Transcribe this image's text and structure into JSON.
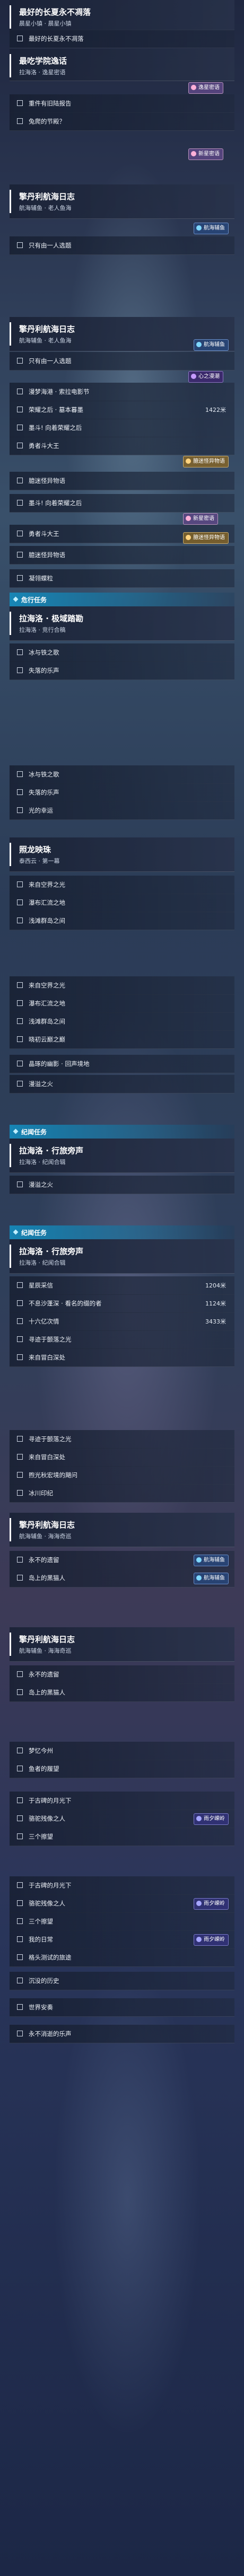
{
  "cards": [
    {
      "title": "最好的长夏永不凋落",
      "sub": "晨星小镇 · 晨星小镇"
    },
    {
      "title": "最吃学院逸话",
      "sub": "拉海洛 · 逸星密语"
    },
    {
      "title": "擎丹利航海日志",
      "sub": "航海辅鱼 · 老人鱼海"
    },
    {
      "title": "擎丹利航海日志",
      "sub": "航海辅鱼 · 老人鱼海"
    },
    {
      "title": "拉海洛 · 极域踏勘",
      "sub": "拉海洛 · 竞行合稿"
    },
    {
      "title": "照龙映珠",
      "sub": "泰西云 · 第一幕"
    },
    {
      "title": "拉海洛 · 行旅旁声",
      "sub": "拉海洛 · 纪闻合辑"
    },
    {
      "title": "拉海洛 · 行旅旁声",
      "sub": "拉海洛 · 纪闻合辑"
    },
    {
      "title": "擎丹利航海日志",
      "sub": "航海辅鱼 · 海海奇巡"
    },
    {
      "title": "擎丹利航海日志",
      "sub": "航海辅鱼 · 海海奇巡"
    }
  ],
  "sections": [
    "危行任务",
    "纪闻任务",
    "纪闻任务"
  ],
  "rows": [
    {
      "label": "最好的长夏永不凋落"
    },
    {
      "label": "重件有旧陆报告"
    },
    {
      "label": "兔爬的节殿？"
    },
    {
      "label": "只有由一人选题"
    },
    {
      "label": "只有由一人选题"
    },
    {
      "label": "漫梦海港 · 索拉电影节"
    },
    {
      "label": "荣耀之后 · 墓本暮墨",
      "value": "1422米"
    },
    {
      "label": "墨斗! 向着荣耀之后"
    },
    {
      "label": "勇者斗大王"
    },
    {
      "label": "臆迷怪异物语"
    },
    {
      "label": "墨斗! 向着荣耀之后"
    },
    {
      "label": "勇者斗大王"
    },
    {
      "label": "臆迷怪异物语"
    },
    {
      "label": "凝翎蝶粒"
    },
    {
      "label": "冰与铁之歌"
    },
    {
      "label": "失落的乐声"
    },
    {
      "label": "冰与铁之歌"
    },
    {
      "label": "失落的乐声"
    },
    {
      "label": "光的幸运"
    },
    {
      "label": "来自空界之光"
    },
    {
      "label": "瀑布汇流之地"
    },
    {
      "label": "浅滩群岛之间"
    },
    {
      "label": "来自空界之光"
    },
    {
      "label": "瀑布汇流之地"
    },
    {
      "label": "浅滩群岛之间"
    },
    {
      "label": "晓初云巅之巅"
    },
    {
      "label": "晶琢的幽影 · 回声境地"
    },
    {
      "label": "漫溢之火"
    },
    {
      "label": "漫溢之火"
    },
    {
      "label": "星辰采信",
      "value": "1204米"
    },
    {
      "label": "不息沙蓬深 · 看名的缀的者",
      "value": "1124米"
    },
    {
      "label": "十六亿次情",
      "value": "3433米"
    },
    {
      "label": "寻迹于颤落之光"
    },
    {
      "label": "来自冒白深处"
    },
    {
      "label": "寻迹于颤落之光"
    },
    {
      "label": "来自冒白深处"
    },
    {
      "label": "煦光秋宏境的飓问"
    },
    {
      "label": "冰川印纪"
    },
    {
      "label": "永不的遗留"
    },
    {
      "label": "岛上的黑猫人"
    },
    {
      "label": "永不的遗留"
    },
    {
      "label": "岛上的黑猫人"
    },
    {
      "label": "梦忆今州"
    },
    {
      "label": "鱼者的履望"
    },
    {
      "label": "于古碑的月光下"
    },
    {
      "label": "骆驼残像之人"
    },
    {
      "label": "三个擦望"
    },
    {
      "label": "于古碑的月光下"
    },
    {
      "label": "骆驼残像之人"
    },
    {
      "label": "三个擦望"
    },
    {
      "label": "我的日常"
    },
    {
      "label": "格头测试的旅途"
    },
    {
      "label": "沉没的历史"
    },
    {
      "label": "世界安奏"
    },
    {
      "label": "永不消逝的乐声"
    }
  ],
  "badges": {
    "hx": "航海辅鱼",
    "xl": "心之漫潮",
    "xp": "新星密语",
    "yx": "臆迷怪异物语",
    "ys": "雨夕嵘岭",
    "xp2": "逸星密语"
  },
  "colors": {
    "accent": "#17a0d8",
    "section": "#148cbe"
  }
}
